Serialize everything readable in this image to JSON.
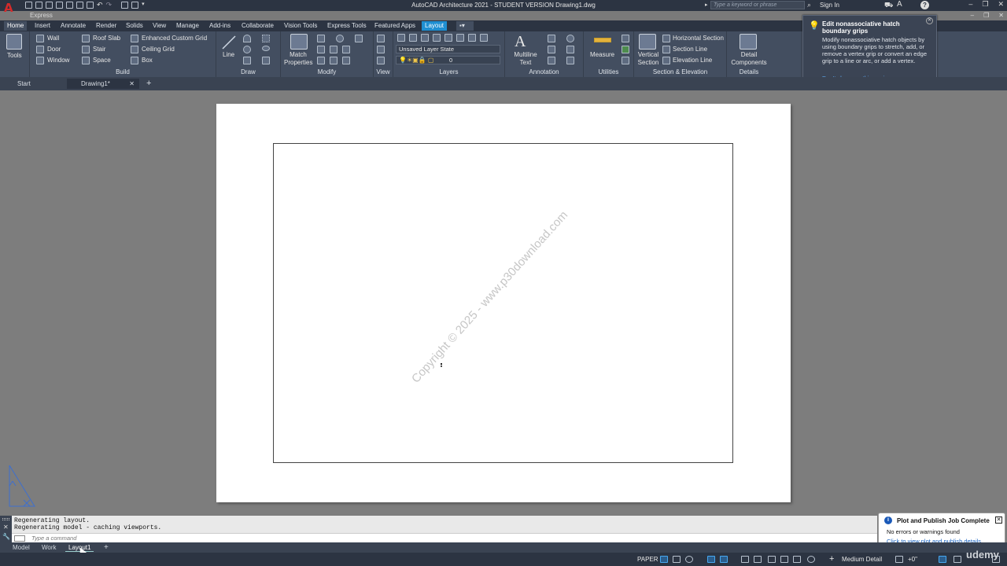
{
  "title_bar": {
    "title": "AutoCAD Architecture 2021 - STUDENT VERSION    Drawing1.dwg",
    "workspace": "Express",
    "search_placeholder": "Type a keyword or phrase",
    "sign_in": "Sign In"
  },
  "ribbon_tabs": [
    "Home",
    "Insert",
    "Annotate",
    "Render",
    "Solids",
    "View",
    "Manage",
    "Add-ins",
    "Collaborate",
    "Vision Tools",
    "Express Tools",
    "Featured Apps",
    "Layout"
  ],
  "active_tab": "Home",
  "contextual_tab": "Layout",
  "panels": {
    "tools": {
      "label": "Tools"
    },
    "build": {
      "label": "Build",
      "items": {
        "wall": "Wall",
        "door": "Door",
        "window": "Window",
        "roof_slab": "Roof Slab",
        "stair": "Stair",
        "space": "Space",
        "enhanced_grid": "Enhanced Custom Grid",
        "ceiling_grid": "Ceiling Grid",
        "box": "Box"
      }
    },
    "draw": {
      "label": "Draw",
      "line": "Line"
    },
    "modify": {
      "label": "Modify",
      "match_properties": "Match Properties"
    },
    "view": {
      "label": "View"
    },
    "layers": {
      "label": "Layers",
      "layer_state": "Unsaved Layer State",
      "current_layer": "0"
    },
    "annotation": {
      "label": "Annotation",
      "multiline_text": "Multiline Text"
    },
    "utilities": {
      "label": "Utilities",
      "measure": "Measure"
    },
    "section_elevation": {
      "label": "Section & Elevation",
      "vertical_section": "Vertical Section",
      "horizontal_section": "Horizontal Section",
      "section_line": "Section Line",
      "elevation_line": "Elevation Line"
    },
    "details": {
      "label": "Details",
      "detail_components": "Detail Components"
    }
  },
  "tooltip": {
    "title": "Edit nonassociative hatch boundary grips",
    "body": "Modify nonassociative hatch objects by using boundary grips to stretch, add, or remove a vertex grip or convert an edge grip to a line or arc, or add a vertex.",
    "link": "Don't show me this again"
  },
  "doc_tabs": [
    "Start",
    "Drawing1*"
  ],
  "active_doc_tab": "Drawing1*",
  "watermark": "Copyright © 2025 - www.p30download.com",
  "command_history": [
    "Regenerating layout.",
    "Regenerating model - caching viewports."
  ],
  "command_placeholder": "Type a command",
  "notification": {
    "title": "Plot and Publish Job Complete",
    "body": "No errors or warnings found",
    "link": "Click to view plot and publish details..."
  },
  "layout_tabs": [
    "Model",
    "Work",
    "Layout1"
  ],
  "active_layout_tab": "Layout1",
  "status_bar": {
    "space": "PAPER",
    "detail_level": "Medium Detail",
    "elevation": "+0\""
  },
  "brand_overlay": "udemy",
  "colors": {
    "ribbon_bg": "#434e60",
    "title_bg": "#2c3442",
    "accent": "#1f8fd2",
    "paper": "#ffffff"
  }
}
